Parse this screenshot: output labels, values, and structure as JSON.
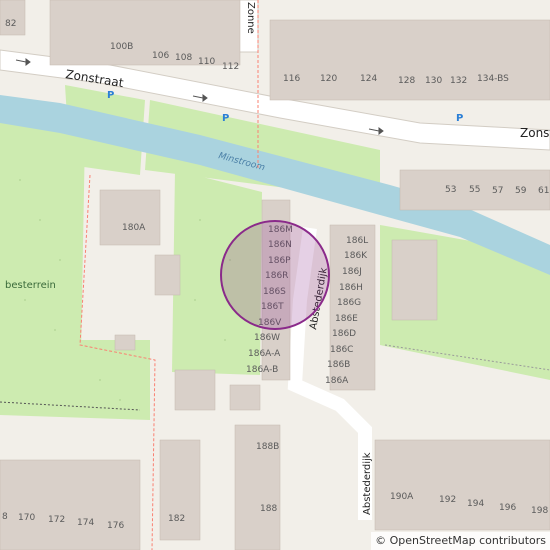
{
  "streets": {
    "zonstraat_left": "Zonstraat",
    "zonstraat_right": "Zonstr",
    "zonnebloem": "Zonne",
    "abstederdijk_upper": "Abstederdijk",
    "abstederdijk_lower": "Abstederdijk"
  },
  "water": {
    "minstroom": "Minstroom"
  },
  "park": {
    "label": "besterrein"
  },
  "parking_symbol": "P",
  "house_numbers": {
    "top_left": [
      "82",
      "100B",
      "106",
      "108",
      "110",
      "112"
    ],
    "top_right": [
      "116",
      "120",
      "124",
      "128",
      "130",
      "132",
      "134-BS"
    ],
    "right_row": [
      "53",
      "55",
      "57",
      "59",
      "61"
    ],
    "lot": "180A",
    "center_column": [
      "186M",
      "186N",
      "186P",
      "186R",
      "186S",
      "186T",
      "186V",
      "186W",
      "186A-A",
      "186A-B"
    ],
    "right_column": [
      "186L",
      "186K",
      "186J",
      "186H",
      "186G",
      "186E",
      "186D",
      "186C",
      "186B",
      "186A"
    ],
    "bottom": [
      "188B",
      "188",
      "182",
      "190A",
      "192",
      "194",
      "196",
      "198"
    ],
    "bottom_left": [
      "8",
      "170",
      "172",
      "174",
      "176"
    ]
  },
  "attribution": {
    "symbol": "©",
    "text": "OpenStreetMap contributors"
  },
  "colors": {
    "water": "#aad3df",
    "park": "#c8facc",
    "grass": "#cdebb0",
    "building": "#d9d0c9",
    "marker": "#8a2a8a"
  }
}
